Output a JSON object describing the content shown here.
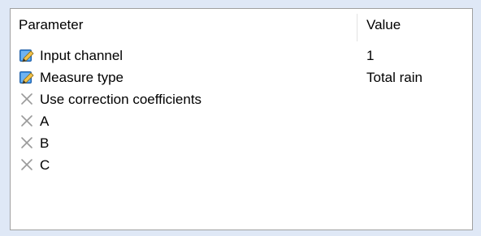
{
  "table": {
    "headers": {
      "parameter": "Parameter",
      "value": "Value"
    },
    "rows": [
      {
        "name": "Input channel",
        "value": "1",
        "icon": "edit-icon"
      },
      {
        "name": "Measure type",
        "value": "Total rain",
        "icon": "edit-icon"
      },
      {
        "name": "Use correction coefficients",
        "value": "",
        "icon": "disabled-x-icon"
      },
      {
        "name": "A",
        "value": "",
        "icon": "disabled-x-icon"
      },
      {
        "name": "B",
        "value": "",
        "icon": "disabled-x-icon"
      },
      {
        "name": "C",
        "value": "",
        "icon": "disabled-x-icon"
      }
    ]
  },
  "colors": {
    "background": "#dfe8f6",
    "border": "#a0a0a0",
    "x_icon": "#9a9a9a"
  }
}
